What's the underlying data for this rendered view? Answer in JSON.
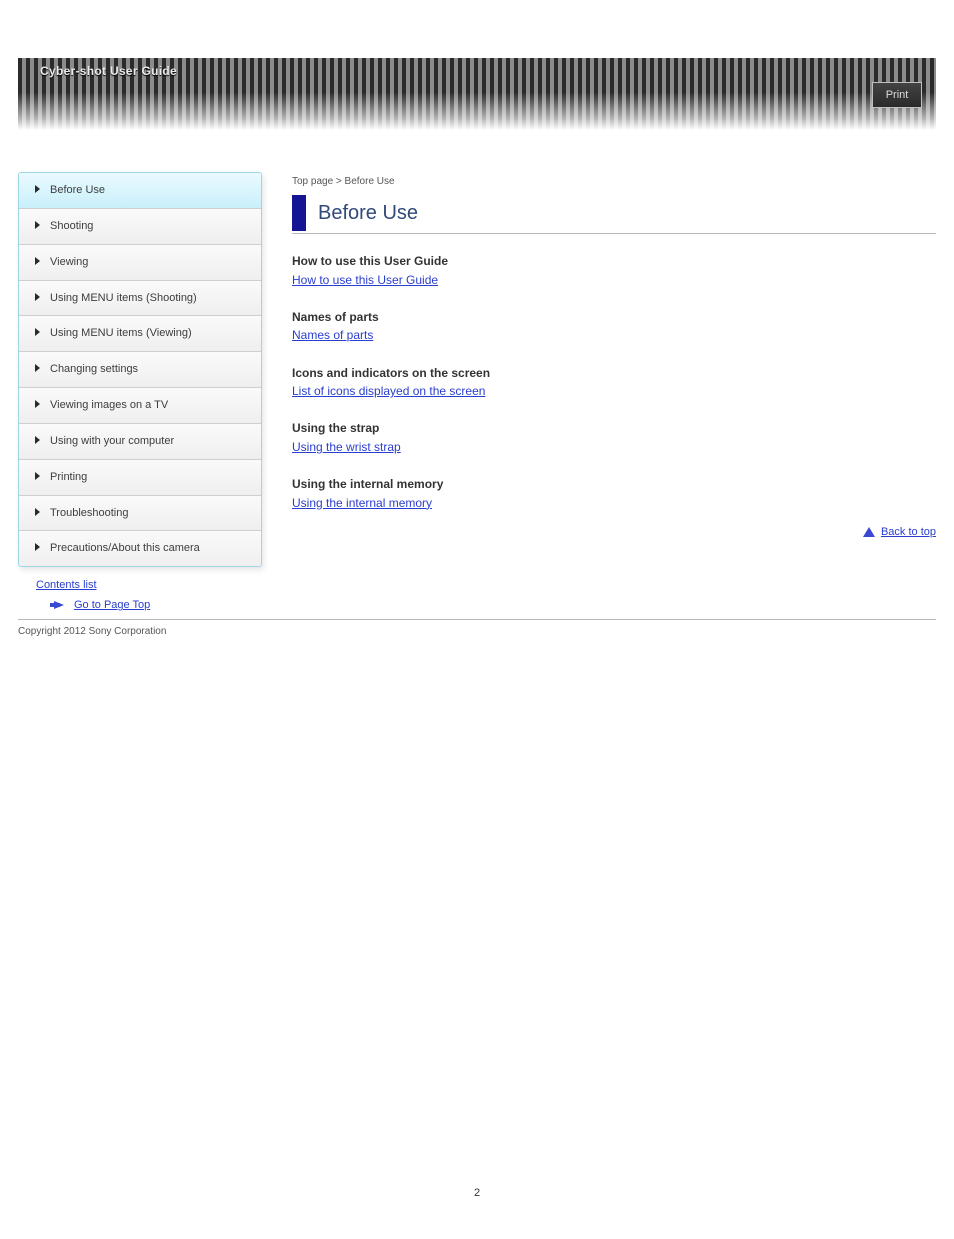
{
  "header": {
    "title": "Cyber-shot User Guide",
    "print_label": "Print"
  },
  "sidebar": {
    "items": [
      {
        "label": "Before Use",
        "active": true
      },
      {
        "label": "Shooting"
      },
      {
        "label": "Viewing"
      },
      {
        "label": "Using MENU items (Shooting)"
      },
      {
        "label": "Using MENU items (Viewing)"
      },
      {
        "label": "Changing settings"
      },
      {
        "label": "Viewing images on a TV"
      },
      {
        "label": "Using with your computer"
      },
      {
        "label": "Printing"
      },
      {
        "label": "Troubleshooting"
      },
      {
        "label": "Precautions/About this camera"
      }
    ],
    "contents_link": "Contents list"
  },
  "main": {
    "breadcrumb": "Top page > Before Use",
    "title": "Before Use",
    "sections": [
      {
        "heading": "How to use this User Guide",
        "link": "How to use this User Guide"
      },
      {
        "heading": "Names of parts",
        "link": "Names of parts"
      },
      {
        "heading": "Icons and indicators on the screen",
        "link": "List of icons displayed on the screen"
      },
      {
        "heading": "Using the strap",
        "link": "Using the wrist strap"
      },
      {
        "heading": "Using the internal memory",
        "link": "Using the internal memory"
      }
    ],
    "back_to_top": "Back to top"
  },
  "footer": {
    "goto_label": "Go to Page Top",
    "copyright": "Copyright 2012 Sony Corporation",
    "page_number": "2"
  }
}
